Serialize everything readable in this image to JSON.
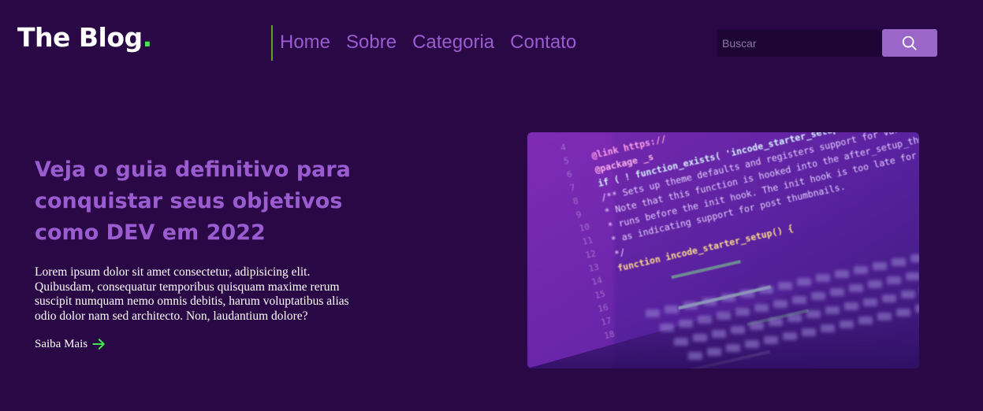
{
  "brand": {
    "logo_text": "The Blog",
    "logo_dot": "."
  },
  "nav": {
    "items": [
      {
        "label": "Home"
      },
      {
        "label": "Sobre"
      },
      {
        "label": "Categoria"
      },
      {
        "label": "Contato"
      }
    ]
  },
  "search": {
    "placeholder": "Buscar",
    "icon": "search-icon"
  },
  "hero": {
    "title": "Veja o guia definitivo para conquistar seus objetivos como DEV em 2022",
    "text": "Lorem ipsum dolor sit amet consectetur, adipisicing elit. Quibusdam, consequatur temporibus quisquam maxime rerum suscipit numquam nemo omnis debitis, harum voluptatibus alias odio dolor nam sed architecto. Non, laudantium dolore?",
    "link_label": "Saiba Mais",
    "link_icon": "arrow-right-icon",
    "image_code": {
      "line_numbers": [
        "4",
        "5",
        "6",
        "7",
        "8",
        "9",
        "10",
        "11",
        "12",
        "13",
        "14",
        "15",
        "16",
        "17",
        "18"
      ],
      "lines": [
        "@link https://",
        "@package _s",
        "if ( ! function_exists( 'incode_starter_setup' ) ) :",
        "/** Sets up theme defaults and registers support for various WordPress",
        " * Note that this function is hooked into the after_setup_theme hook,",
        " * runs before the init hook. The init hook is too late for some fea",
        " * as indicating support for post thumbnails.",
        " */",
        "function incode_starter_setup() {"
      ]
    }
  },
  "colors": {
    "background": "#290845",
    "accent": "#9a5cd0",
    "logo_dot": "#42e84c",
    "arrow": "#42e84c",
    "search_button": "#9a67c8"
  }
}
